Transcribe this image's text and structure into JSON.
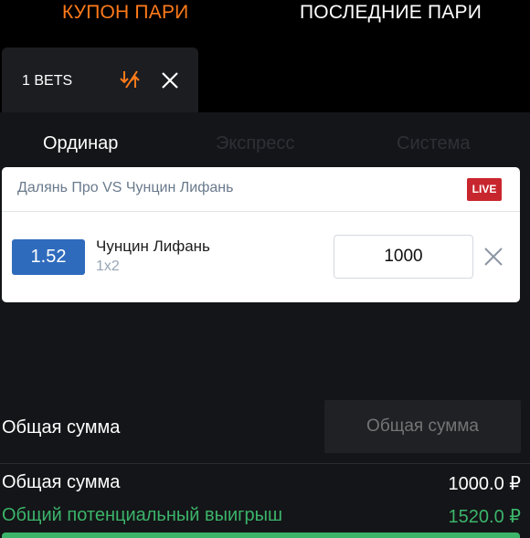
{
  "top_tabs": {
    "coupon": "КУПОН ПАРИ",
    "last": "ПОСЛЕДНИЕ ПАРИ"
  },
  "bets_tab": {
    "label": "1 BETS"
  },
  "mode_tabs": {
    "single": "Ординар",
    "express": "Экспресс",
    "system": "Система"
  },
  "bet_card": {
    "match": "Далянь Про VS Чунцин Лифань",
    "live_badge": "LIVE",
    "odds": "1.52",
    "pick": "Чунцин Лифань",
    "market": "1x2",
    "stake": "1000"
  },
  "total": {
    "label": "Общая сумма",
    "input_placeholder": "Общая сумма"
  },
  "summary": {
    "total_label": "Общая сумма",
    "total_value": "1000.0 ₽",
    "win_label": "Общий потенциальный выигрыш",
    "win_value": "1520.0 ₽"
  },
  "colors": {
    "accent": "#ff7a1a",
    "odds_blue": "#2f6bbd",
    "live_red": "#c8262e",
    "win_green": "#3bb46a"
  }
}
